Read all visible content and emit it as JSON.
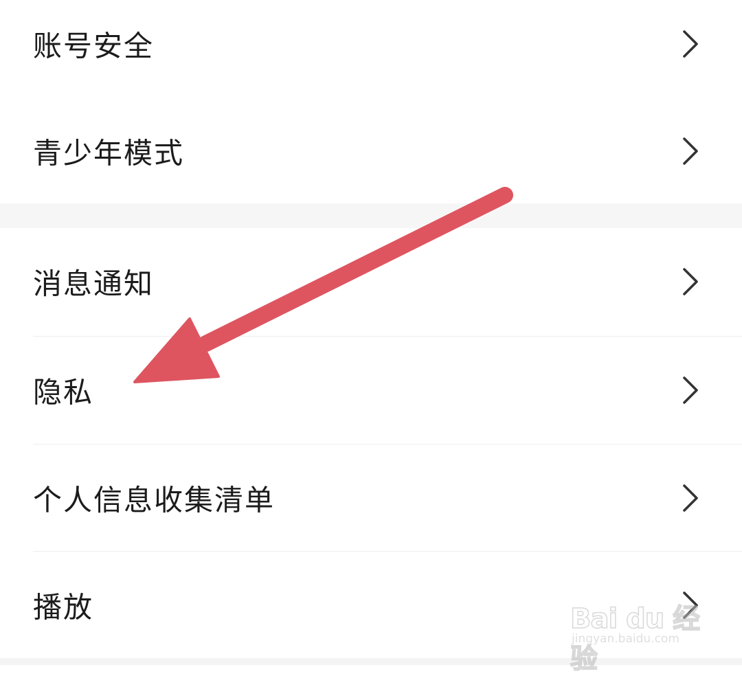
{
  "settings": {
    "group1": [
      {
        "label": "账号安全"
      },
      {
        "label": "青少年模式"
      }
    ],
    "group2": [
      {
        "label": "消息通知"
      },
      {
        "label": "隐私"
      },
      {
        "label": "个人信息收集清单"
      },
      {
        "label": "播放"
      }
    ]
  },
  "annotation": {
    "arrow_color": "#de5560"
  },
  "watermark": {
    "brand": "Bai du 经验",
    "url": "jingyan.baidu.com"
  },
  "icons": {
    "row_chevron": "chevron-right-icon"
  }
}
